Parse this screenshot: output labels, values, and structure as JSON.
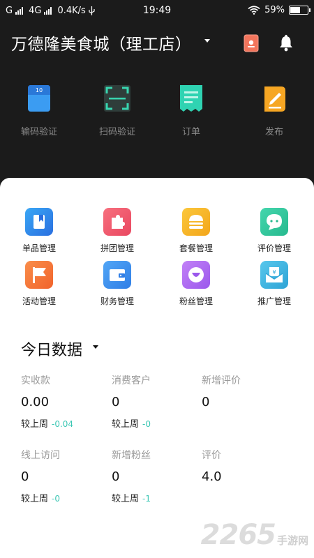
{
  "status": {
    "carrier": "G",
    "network": "4G",
    "speed": "0.4K/s",
    "time": "19:49",
    "battery_text": "59%",
    "battery_level": 0.59
  },
  "header": {
    "store_name": "万德隆美食城（理工店）"
  },
  "top_actions": [
    {
      "label": "输码验证",
      "icon": "input-code-icon"
    },
    {
      "label": "扫码验证",
      "icon": "scan-code-icon"
    },
    {
      "label": "订单",
      "icon": "order-icon"
    },
    {
      "label": "发布",
      "icon": "publish-icon"
    }
  ],
  "grid": [
    {
      "label": "单品管理",
      "icon": "product-icon",
      "color": "#2f87ee"
    },
    {
      "label": "拼团管理",
      "icon": "puzzle-icon",
      "color": "#f0596b"
    },
    {
      "label": "套餐管理",
      "icon": "burger-icon",
      "color": "#f6b92d"
    },
    {
      "label": "评价管理",
      "icon": "chat-icon",
      "color": "#33c9a0"
    },
    {
      "label": "活动管理",
      "icon": "flag-icon",
      "color": "#f5783b"
    },
    {
      "label": "财务管理",
      "icon": "wallet-icon",
      "color": "#3c8ff0"
    },
    {
      "label": "粉丝管理",
      "icon": "fan-icon",
      "color": "#b06ff0"
    },
    {
      "label": "推广管理",
      "icon": "promo-icon",
      "color": "#3fb8e0"
    }
  ],
  "today": {
    "title": "今日数据",
    "compare_label": "较上周",
    "stats": [
      {
        "label": "实收款",
        "value": "0.00",
        "delta": "-0.04"
      },
      {
        "label": "消费客户",
        "value": "0",
        "delta": "-0"
      },
      {
        "label": "新增评价",
        "value": "0",
        "delta": null
      },
      {
        "label": "线上访问",
        "value": "0",
        "delta": "-0"
      },
      {
        "label": "新增粉丝",
        "value": "0",
        "delta": "-1"
      },
      {
        "label": "评价",
        "value": "4.0",
        "delta": null
      }
    ]
  },
  "watermark": {
    "number": "2265",
    "text": "手游网"
  }
}
